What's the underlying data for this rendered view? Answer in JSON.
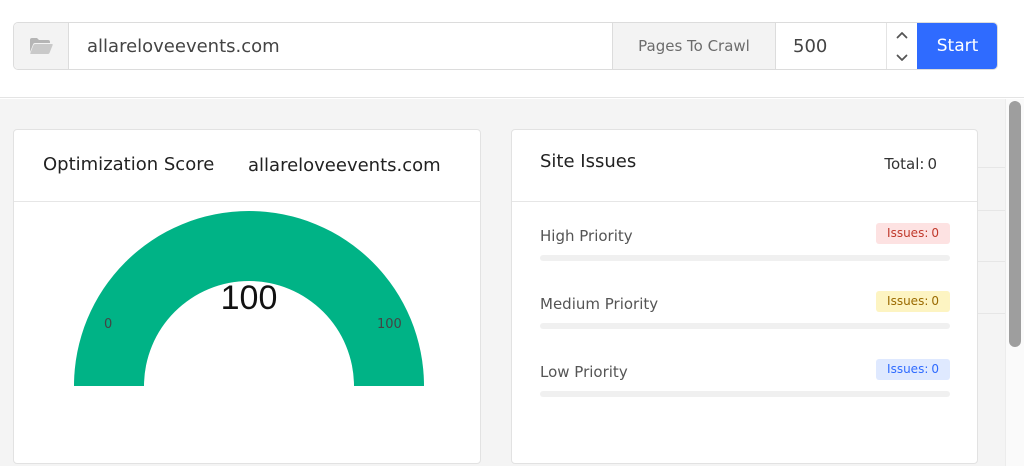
{
  "crawl_bar": {
    "folder_icon": "folder-icon",
    "url_value": "allareloveevents.com",
    "pages_label": "Pages To Crawl",
    "pages_value": "500",
    "step_up_icon": "chevron-up-icon",
    "step_down_icon": "chevron-down-icon",
    "start_label": "Start",
    "accent_color": "#2f6bff"
  },
  "score_card": {
    "title": "Optimization Score",
    "domain": "allareloveevents.com",
    "gauge": {
      "value": "100",
      "min": "0",
      "max": "100",
      "fill_fraction": 1.0,
      "color": "#00b386"
    }
  },
  "issues_card": {
    "title": "Site Issues",
    "total_label": "Total:",
    "total_value": "0",
    "rows": [
      {
        "label": "High Priority",
        "badge_label": "Issues:",
        "badge_count": "0",
        "color": "#c0392b"
      },
      {
        "label": "Medium Priority",
        "badge_label": "Issues:",
        "badge_count": "0",
        "color": "#9a6a00"
      },
      {
        "label": "Low Priority",
        "badge_label": "Issues:",
        "badge_count": "0",
        "color": "#2f6bff"
      }
    ]
  }
}
